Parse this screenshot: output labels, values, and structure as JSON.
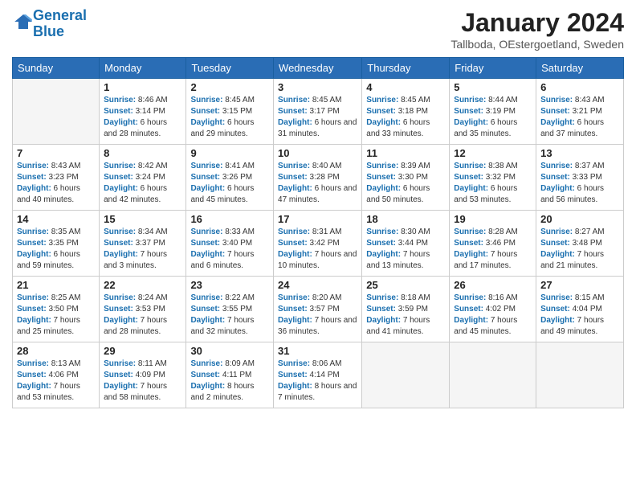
{
  "logo": {
    "line1": "General",
    "line2": "Blue"
  },
  "title": "January 2024",
  "location": "Tallboda, OEstergoetland, Sweden",
  "days_header": [
    "Sunday",
    "Monday",
    "Tuesday",
    "Wednesday",
    "Thursday",
    "Friday",
    "Saturday"
  ],
  "weeks": [
    [
      {
        "day": "",
        "sunrise": "",
        "sunset": "",
        "daylight": ""
      },
      {
        "day": "1",
        "sunrise": "8:46 AM",
        "sunset": "3:14 PM",
        "daylight": "6 hours and 28 minutes."
      },
      {
        "day": "2",
        "sunrise": "8:45 AM",
        "sunset": "3:15 PM",
        "daylight": "6 hours and 29 minutes."
      },
      {
        "day": "3",
        "sunrise": "8:45 AM",
        "sunset": "3:17 PM",
        "daylight": "6 hours and 31 minutes."
      },
      {
        "day": "4",
        "sunrise": "8:45 AM",
        "sunset": "3:18 PM",
        "daylight": "6 hours and 33 minutes."
      },
      {
        "day": "5",
        "sunrise": "8:44 AM",
        "sunset": "3:19 PM",
        "daylight": "6 hours and 35 minutes."
      },
      {
        "day": "6",
        "sunrise": "8:43 AM",
        "sunset": "3:21 PM",
        "daylight": "6 hours and 37 minutes."
      }
    ],
    [
      {
        "day": "7",
        "sunrise": "8:43 AM",
        "sunset": "3:23 PM",
        "daylight": "6 hours and 40 minutes."
      },
      {
        "day": "8",
        "sunrise": "8:42 AM",
        "sunset": "3:24 PM",
        "daylight": "6 hours and 42 minutes."
      },
      {
        "day": "9",
        "sunrise": "8:41 AM",
        "sunset": "3:26 PM",
        "daylight": "6 hours and 45 minutes."
      },
      {
        "day": "10",
        "sunrise": "8:40 AM",
        "sunset": "3:28 PM",
        "daylight": "6 hours and 47 minutes."
      },
      {
        "day": "11",
        "sunrise": "8:39 AM",
        "sunset": "3:30 PM",
        "daylight": "6 hours and 50 minutes."
      },
      {
        "day": "12",
        "sunrise": "8:38 AM",
        "sunset": "3:32 PM",
        "daylight": "6 hours and 53 minutes."
      },
      {
        "day": "13",
        "sunrise": "8:37 AM",
        "sunset": "3:33 PM",
        "daylight": "6 hours and 56 minutes."
      }
    ],
    [
      {
        "day": "14",
        "sunrise": "8:35 AM",
        "sunset": "3:35 PM",
        "daylight": "6 hours and 59 minutes."
      },
      {
        "day": "15",
        "sunrise": "8:34 AM",
        "sunset": "3:37 PM",
        "daylight": "7 hours and 3 minutes."
      },
      {
        "day": "16",
        "sunrise": "8:33 AM",
        "sunset": "3:40 PM",
        "daylight": "7 hours and 6 minutes."
      },
      {
        "day": "17",
        "sunrise": "8:31 AM",
        "sunset": "3:42 PM",
        "daylight": "7 hours and 10 minutes."
      },
      {
        "day": "18",
        "sunrise": "8:30 AM",
        "sunset": "3:44 PM",
        "daylight": "7 hours and 13 minutes."
      },
      {
        "day": "19",
        "sunrise": "8:28 AM",
        "sunset": "3:46 PM",
        "daylight": "7 hours and 17 minutes."
      },
      {
        "day": "20",
        "sunrise": "8:27 AM",
        "sunset": "3:48 PM",
        "daylight": "7 hours and 21 minutes."
      }
    ],
    [
      {
        "day": "21",
        "sunrise": "8:25 AM",
        "sunset": "3:50 PM",
        "daylight": "7 hours and 25 minutes."
      },
      {
        "day": "22",
        "sunrise": "8:24 AM",
        "sunset": "3:53 PM",
        "daylight": "7 hours and 28 minutes."
      },
      {
        "day": "23",
        "sunrise": "8:22 AM",
        "sunset": "3:55 PM",
        "daylight": "7 hours and 32 minutes."
      },
      {
        "day": "24",
        "sunrise": "8:20 AM",
        "sunset": "3:57 PM",
        "daylight": "7 hours and 36 minutes."
      },
      {
        "day": "25",
        "sunrise": "8:18 AM",
        "sunset": "3:59 PM",
        "daylight": "7 hours and 41 minutes."
      },
      {
        "day": "26",
        "sunrise": "8:16 AM",
        "sunset": "4:02 PM",
        "daylight": "7 hours and 45 minutes."
      },
      {
        "day": "27",
        "sunrise": "8:15 AM",
        "sunset": "4:04 PM",
        "daylight": "7 hours and 49 minutes."
      }
    ],
    [
      {
        "day": "28",
        "sunrise": "8:13 AM",
        "sunset": "4:06 PM",
        "daylight": "7 hours and 53 minutes."
      },
      {
        "day": "29",
        "sunrise": "8:11 AM",
        "sunset": "4:09 PM",
        "daylight": "7 hours and 58 minutes."
      },
      {
        "day": "30",
        "sunrise": "8:09 AM",
        "sunset": "4:11 PM",
        "daylight": "8 hours and 2 minutes."
      },
      {
        "day": "31",
        "sunrise": "8:06 AM",
        "sunset": "4:14 PM",
        "daylight": "8 hours and 7 minutes."
      },
      {
        "day": "",
        "sunrise": "",
        "sunset": "",
        "daylight": ""
      },
      {
        "day": "",
        "sunrise": "",
        "sunset": "",
        "daylight": ""
      },
      {
        "day": "",
        "sunrise": "",
        "sunset": "",
        "daylight": ""
      }
    ]
  ],
  "labels": {
    "sunrise": "Sunrise:",
    "sunset": "Sunset:",
    "daylight": "Daylight:"
  }
}
